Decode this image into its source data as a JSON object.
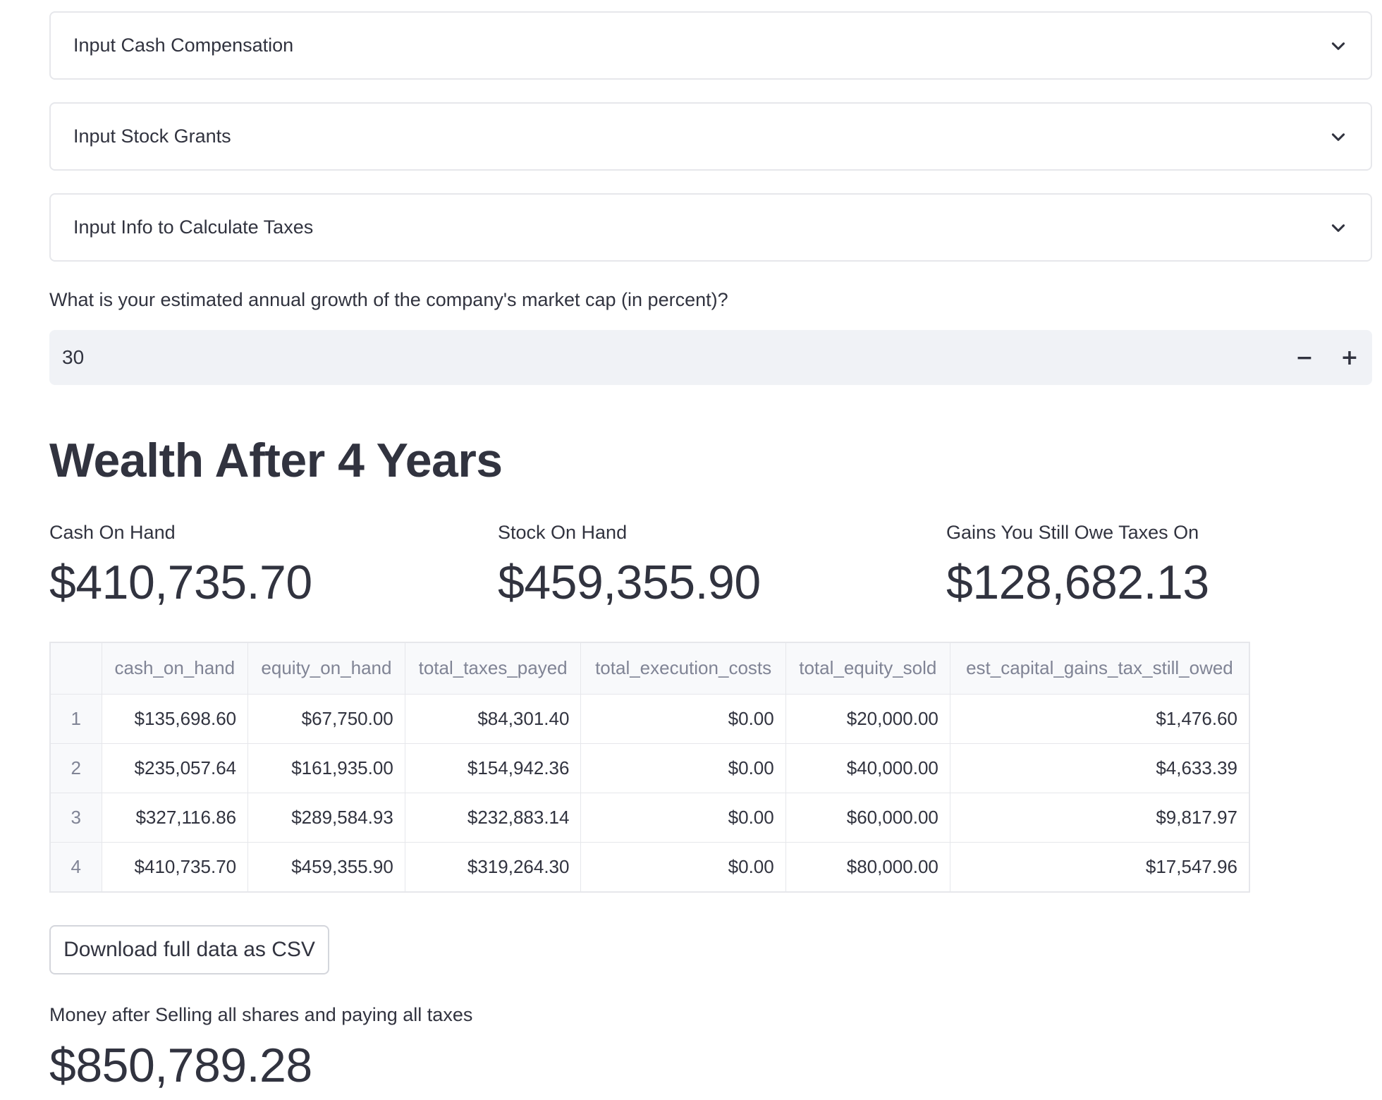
{
  "expanders": [
    {
      "label": "Input Cash Compensation",
      "icon": "chevron-down-icon"
    },
    {
      "label": "Input Stock Grants",
      "icon": "chevron-down-icon"
    },
    {
      "label": "Input Info to Calculate Taxes",
      "icon": "chevron-down-icon"
    }
  ],
  "growth_input": {
    "question": "What is your estimated annual growth of the company's market cap (in percent)?",
    "value": "30",
    "decrement_label": "−",
    "increment_label": "+"
  },
  "heading": "Wealth After 4 Years",
  "metrics": [
    {
      "label": "Cash On Hand",
      "value": "$410,735.70"
    },
    {
      "label": "Stock On Hand",
      "value": "$459,355.90"
    },
    {
      "label": "Gains You Still Owe Taxes On",
      "value": "$128,682.13"
    }
  ],
  "table": {
    "columns": [
      "",
      "cash_on_hand",
      "equity_on_hand",
      "total_taxes_payed",
      "total_execution_costs",
      "total_equity_sold",
      "est_capital_gains_tax_still_owed"
    ],
    "rows": [
      [
        "1",
        "$135,698.60",
        "$67,750.00",
        "$84,301.40",
        "$0.00",
        "$20,000.00",
        "$1,476.60"
      ],
      [
        "2",
        "$235,057.64",
        "$161,935.00",
        "$154,942.36",
        "$0.00",
        "$40,000.00",
        "$4,633.39"
      ],
      [
        "3",
        "$327,116.86",
        "$289,584.93",
        "$232,883.14",
        "$0.00",
        "$60,000.00",
        "$9,817.97"
      ],
      [
        "4",
        "$410,735.70",
        "$459,355.90",
        "$319,264.30",
        "$0.00",
        "$80,000.00",
        "$17,547.96"
      ]
    ]
  },
  "download_button": {
    "label": "Download full data as CSV"
  },
  "final_metric": {
    "label": "Money after Selling all shares and paying all taxes",
    "value": "$850,789.28"
  },
  "colors": {
    "text": "#31333f",
    "muted": "#808495",
    "border": "#e6e7eb",
    "input_bg": "#f0f2f6"
  }
}
